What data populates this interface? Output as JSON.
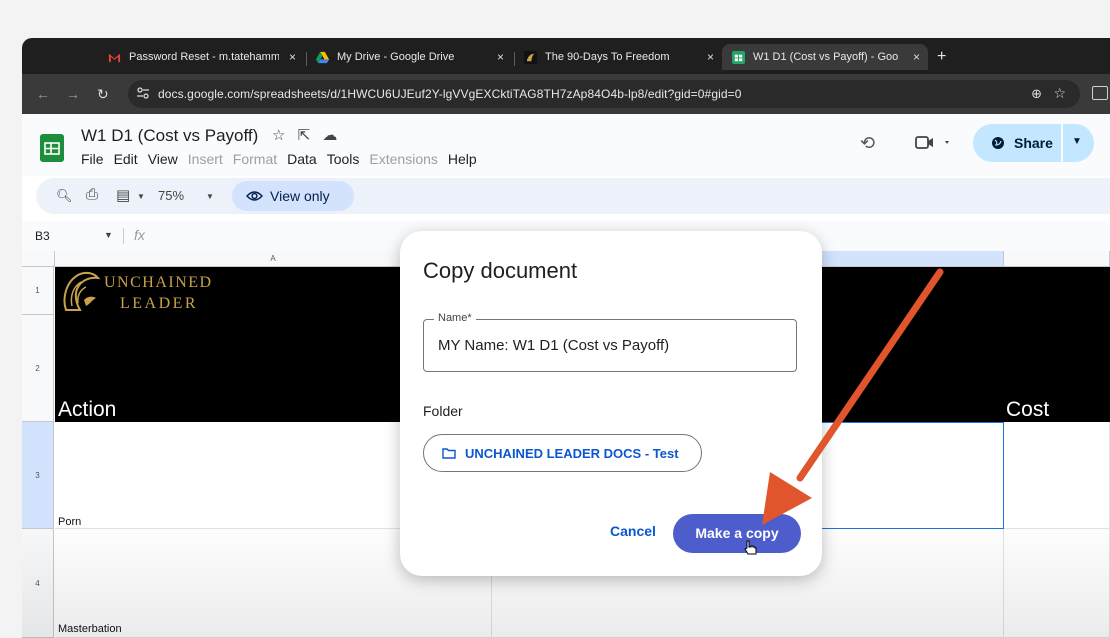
{
  "browser": {
    "tabs": [
      {
        "title": "Password Reset - m.tatehamm",
        "favicon": "gmail-icon"
      },
      {
        "title": "My Drive - Google Drive",
        "favicon": "google-drive-icon"
      },
      {
        "title": "The 90-Days To Freedom",
        "favicon": "site-icon"
      },
      {
        "title": "W1 D1 (Cost vs Payoff) - Goo",
        "favicon": "google-sheets-icon"
      }
    ],
    "new_tab": "+",
    "close": "×",
    "url": "docs.google.com/spreadsheets/d/1HWCU6UJEuf2Y-lgVVgEXCktiTAG8TH7zAp84O4b-lp8/edit?gid=0#gid=0"
  },
  "docs": {
    "title": "W1 D1 (Cost vs Payoff)",
    "menus": [
      {
        "label": "File",
        "enabled": true
      },
      {
        "label": "Edit",
        "enabled": true
      },
      {
        "label": "View",
        "enabled": true
      },
      {
        "label": "Insert",
        "enabled": false
      },
      {
        "label": "Format",
        "enabled": false
      },
      {
        "label": "Data",
        "enabled": true
      },
      {
        "label": "Tools",
        "enabled": true
      },
      {
        "label": "Extensions",
        "enabled": false
      },
      {
        "label": "Help",
        "enabled": true
      }
    ],
    "share_label": "Share",
    "zoom": "75%",
    "view_only_label": "View only",
    "cell_ref": "B3",
    "fx": "fx"
  },
  "sheet": {
    "columns": [
      "A",
      "",
      ""
    ],
    "rows": [
      "1",
      "2",
      "3",
      "4"
    ],
    "brand_line1": "UNCHAINED",
    "brand_line2": "LEADER",
    "header_action": "Action",
    "header_cost": "Cost",
    "row3_a": "Porn",
    "row4_a": "Masterbation"
  },
  "dialog": {
    "title": "Copy document",
    "name_label": "Name*",
    "name_value": "MY Name: W1 D1 (Cost vs Payoff)",
    "folder_label": "Folder",
    "folder_value": "UNCHAINED LEADER DOCS - Test",
    "cancel_label": "Cancel",
    "confirm_label": "Make a copy"
  },
  "colors": {
    "accent": "#4e5dcc",
    "link": "#0b57d0",
    "arrow": "#e0552b",
    "brand_gold": "#c9a24a"
  }
}
